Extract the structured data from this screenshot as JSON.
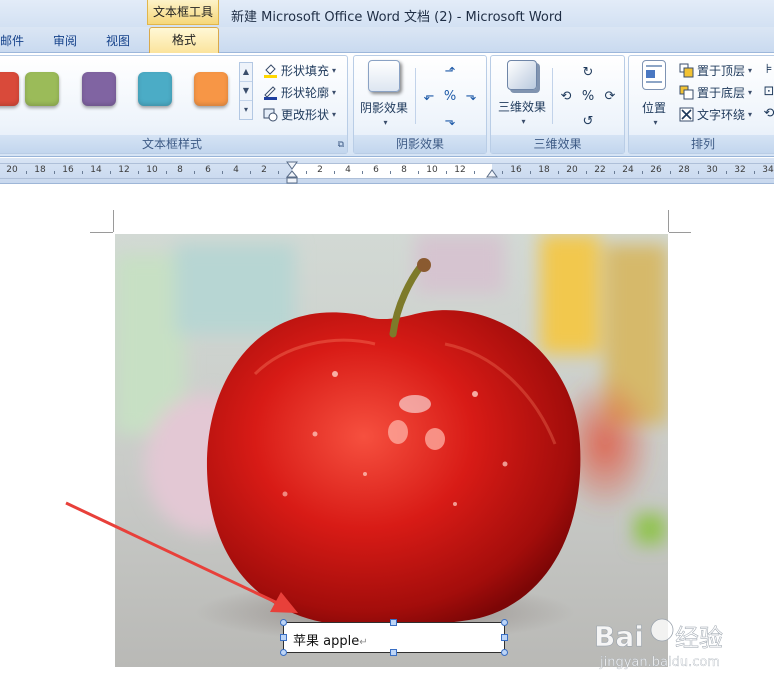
{
  "titlebar": {
    "context_tab": "文本框工具",
    "window_title": "新建 Microsoft Office Word 文档 (2) - Microsoft Word"
  },
  "tabs": [
    {
      "label": "邮件"
    },
    {
      "label": "审阅"
    },
    {
      "label": "视图"
    },
    {
      "label": "格式",
      "active": true
    }
  ],
  "ribbon": {
    "textbox_styles": {
      "label": "文本框样式",
      "swatches": [
        "#d94a3a",
        "#9bbb59",
        "#8064a2",
        "#4bacc6",
        "#f79646"
      ],
      "shape_fill": "形状填充",
      "shape_outline": "形状轮廓",
      "change_shape": "更改形状"
    },
    "shadow_effects": {
      "label": "阴影效果",
      "button": "阴影效果"
    },
    "threed_effects": {
      "label": "三维效果",
      "button": "三维效果"
    },
    "arrange": {
      "label": "排列",
      "position": "位置",
      "bring_to_front": "置于顶层",
      "send_to_back": "置于底层",
      "text_wrapping": "文字环绕"
    }
  },
  "ruler": {
    "labels": [
      "20",
      "18",
      "16",
      "14",
      "12",
      "10",
      "8",
      "6",
      "4",
      "2",
      "2",
      "4",
      "6",
      "8",
      "10",
      "12",
      "16",
      "18",
      "20",
      "22",
      "24",
      "26",
      "28",
      "30",
      "32",
      "34"
    ]
  },
  "document": {
    "textbox_text": "苹果  apple",
    "paragraph_mark": "↵"
  },
  "watermark": {
    "brand": "Baidu经验",
    "url": "jingyan.baidu.com"
  },
  "colors": {
    "ribbon_blue": "#15428b",
    "annotation_arrow": "#e8403a",
    "context_tab": "#f6d77a"
  }
}
